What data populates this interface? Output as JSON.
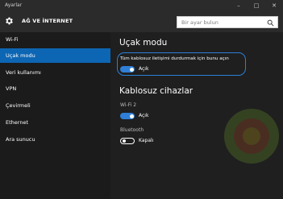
{
  "window": {
    "app_title": "Ayarlar",
    "controls": {
      "minimize": "–",
      "maximize": "□",
      "close": "✕"
    }
  },
  "header": {
    "icon": "gear-icon",
    "title": "AĞ VE İNTERNET",
    "search": {
      "placeholder": "Bir ayar bulun",
      "icon": "search-icon"
    }
  },
  "sidebar": {
    "items": [
      {
        "label": "Wi-Fi",
        "active": false
      },
      {
        "label": "Uçak modu",
        "active": true
      },
      {
        "label": "Veri kullanımı",
        "active": false
      },
      {
        "label": "VPN",
        "active": false
      },
      {
        "label": "Çevirmeli",
        "active": false
      },
      {
        "label": "Ethernet",
        "active": false
      },
      {
        "label": "Ara sunucu",
        "active": false
      }
    ]
  },
  "main": {
    "airplane": {
      "heading": "Uçak modu",
      "description": "Tüm kablosuz iletişimi durdurmak için bunu açın",
      "toggle": {
        "state": "on",
        "label": "Açık"
      }
    },
    "wireless": {
      "heading": "Kablosuz cihazlar",
      "wifi": {
        "name": "Wi-Fi 2",
        "toggle": {
          "state": "on",
          "label": "Açık"
        }
      },
      "bluetooth": {
        "name": "Bluetooth",
        "toggle": {
          "state": "off",
          "label": "Kapalı"
        }
      }
    }
  },
  "colors": {
    "accent": "#0d66b3",
    "toggle_on": "#2f7fd6",
    "highlight_border": "#2b7fd6",
    "sidebar_bg": "#1b1b1b",
    "content_bg": "#1f1f1f"
  }
}
